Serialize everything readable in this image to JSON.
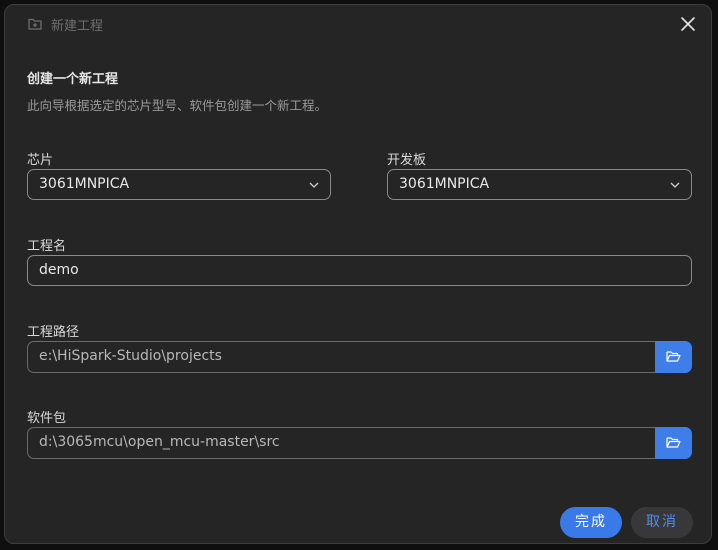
{
  "dialog": {
    "title": "新建工程",
    "heading": "创建一个新工程",
    "subtitle": "此向导根据选定的芯片型号、软件包创建一个新工程。"
  },
  "fields": {
    "chip": {
      "label": "芯片",
      "value": "3061MNPICA"
    },
    "board": {
      "label": "开发板",
      "value": "3061MNPICA"
    },
    "project_name": {
      "label": "工程名",
      "value": "demo"
    },
    "project_path": {
      "label": "工程路径",
      "value": "e:\\HiSpark-Studio\\projects"
    },
    "sdk_package": {
      "label": "软件包",
      "value": "d:\\3065mcu\\open_mcu-master\\src"
    }
  },
  "buttons": {
    "finish": "完成",
    "cancel": "取消"
  },
  "icons": {
    "title": "new-project-icon",
    "close": "close-icon",
    "dropdown": "chevron-down-icon",
    "browse": "folder-open-icon"
  },
  "colors": {
    "accent": "#3a7ae8",
    "background": "#252526",
    "cancel_text": "#4d8ef0"
  }
}
